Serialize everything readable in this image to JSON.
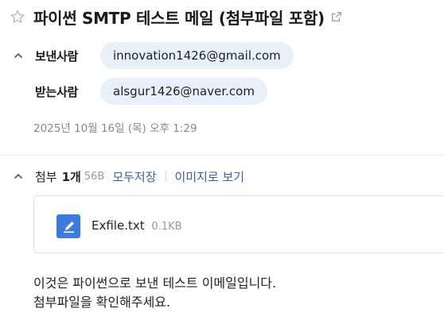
{
  "subject": "파이썬 SMTP 테스트 메일 (첨부파일 포함)",
  "sender": {
    "label": "보낸사람",
    "email": "innovation1426@gmail.com"
  },
  "recipient": {
    "label": "받는사람",
    "email": "alsgur1426@naver.com"
  },
  "date": "2025년 10월 16일 (목) 오후 1:29",
  "attachments": {
    "title": "첨부",
    "count": "1개",
    "total_size": "56B",
    "save_all_label": "모두저장",
    "view_images_label": "이미지로 보기",
    "files": [
      {
        "name": "Exfile.txt",
        "size": "0.1KB"
      }
    ]
  },
  "body": {
    "line1": "이것은 파이썬으로 보낸 테스트 이메일입니다.",
    "line2": "첨부파일을 확인해주세요."
  },
  "colors": {
    "chip_bg": "#e7f0fb",
    "link": "#3d5fa8",
    "file_icon": "#3b7be0"
  }
}
